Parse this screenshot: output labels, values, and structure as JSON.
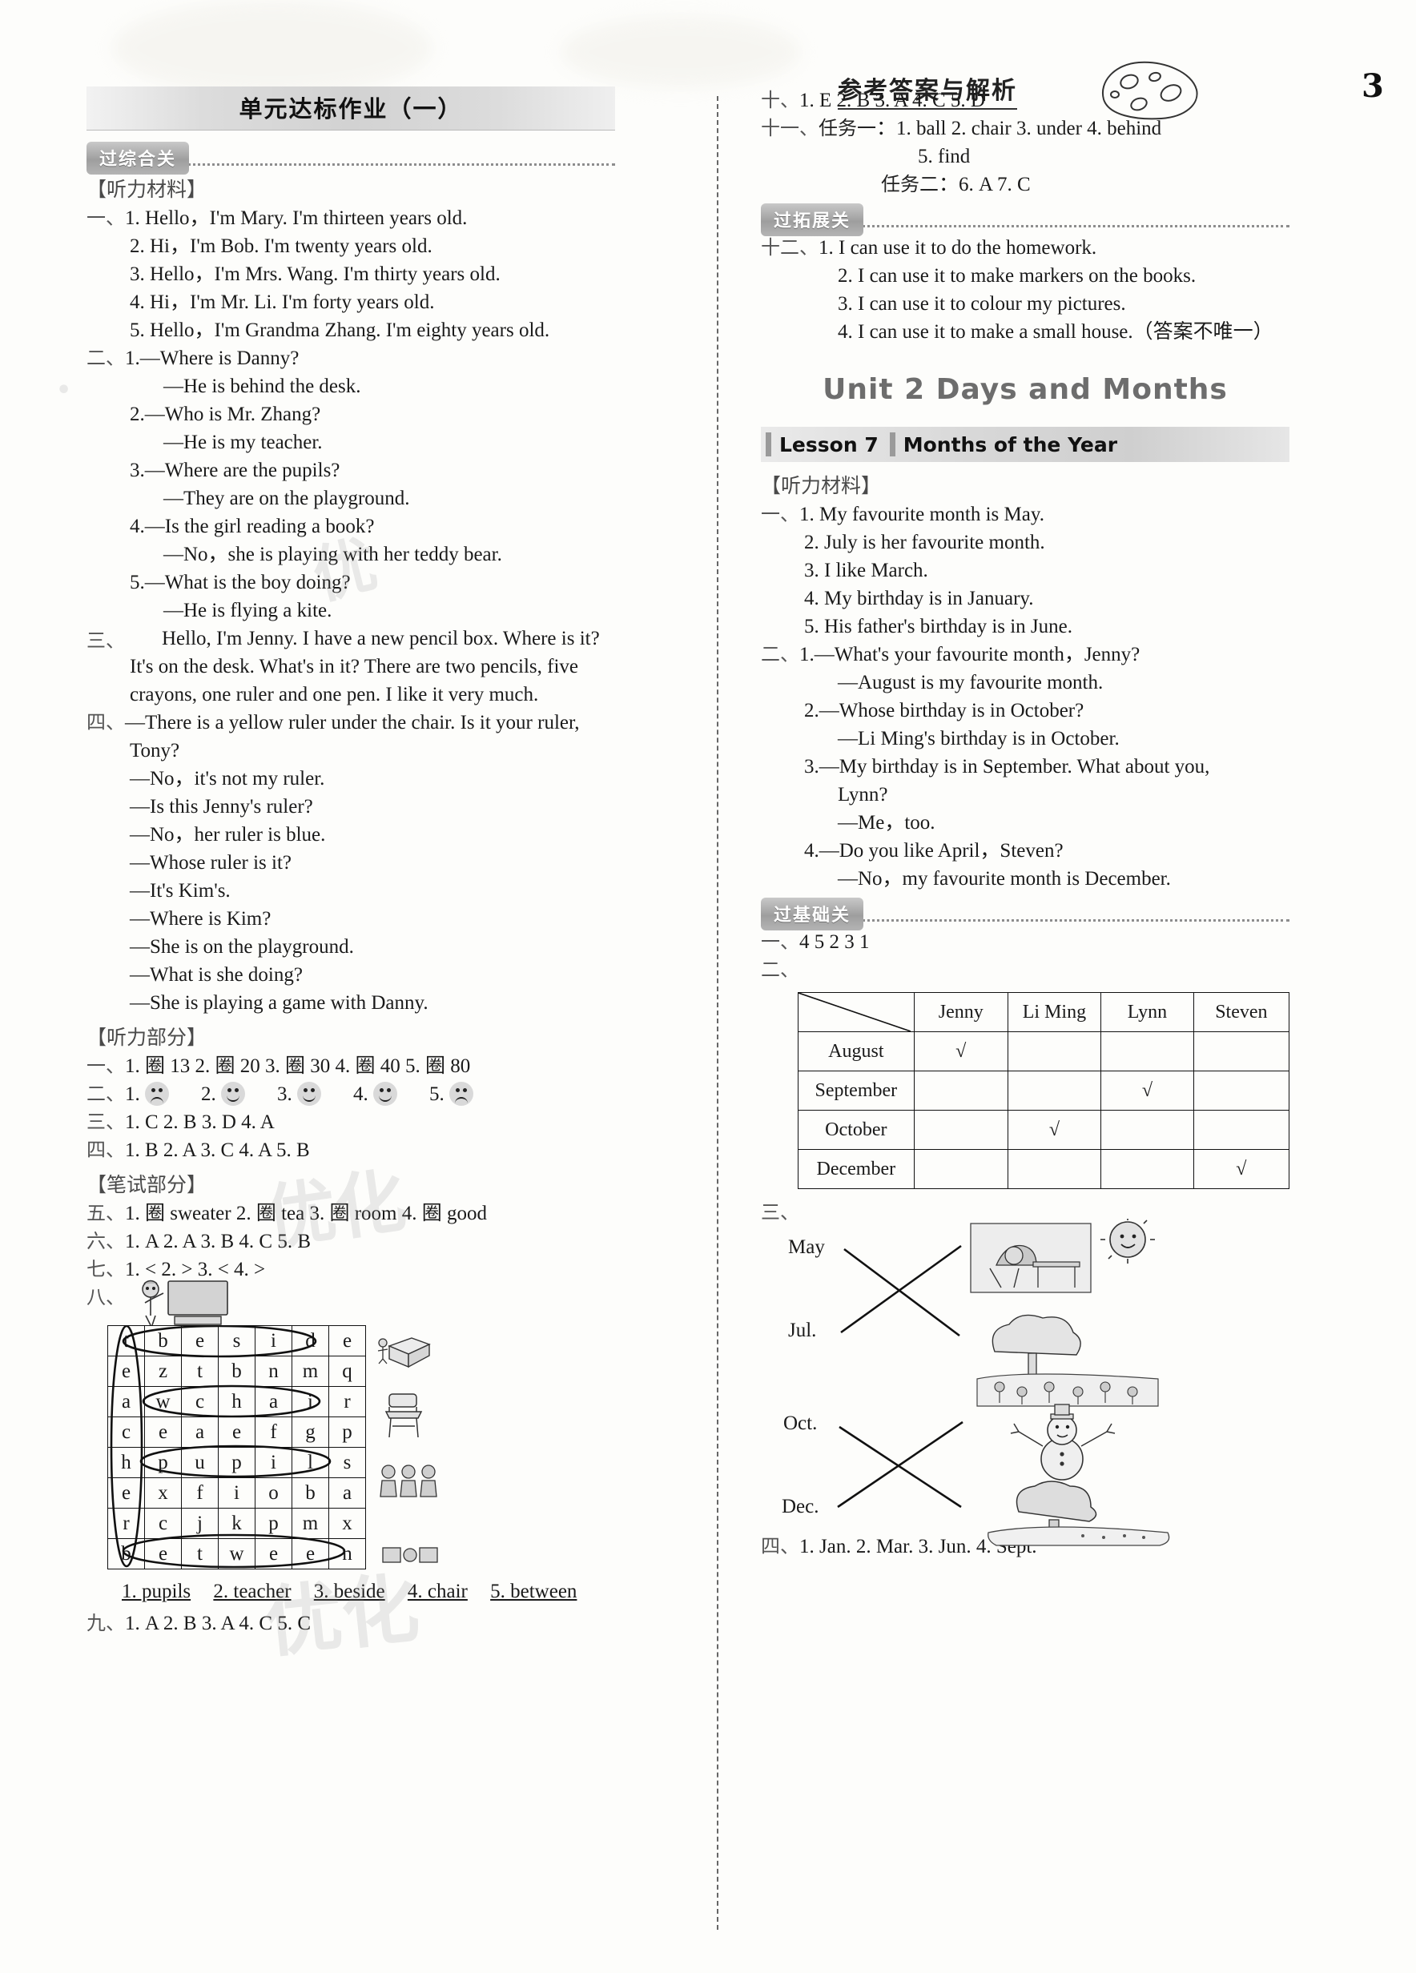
{
  "header": {
    "title": "参考答案与解析",
    "page_number": "3"
  },
  "left_column": {
    "unit_banner": "单元达标作业（一）",
    "gate_1": "过综合关",
    "listening_material_label": "【听力材料】",
    "listening_material": [
      {
        "num": "一、",
        "items": [
          "1. Hello，I'm Mary.  I'm thirteen years old.",
          "2. Hi，I'm Bob.  I'm twenty years old.",
          "3. Hello，I'm Mrs. Wang.  I'm thirty years old.",
          "4. Hi，I'm Mr. Li.  I'm forty years old.",
          "5. Hello，I'm Grandma Zhang.  I'm eighty years old."
        ]
      },
      {
        "num": "二、",
        "items": [
          "1.—Where is Danny?",
          "—He is behind the desk.",
          "2.—Who is Mr. Zhang?",
          "—He is my teacher.",
          "3.—Where are the pupils?",
          "—They are on the playground.",
          "4.—Is the girl reading a book?",
          "—No，she is playing with her teddy bear.",
          "5.—What is the boy doing?",
          "—He is flying a kite."
        ]
      },
      {
        "num": "三、",
        "paragraph": "Hello, I'm Jenny.  I have a new pencil box.  Where is it? It's on the desk.  What's in it? There are two pencils, five crayons, one ruler and one pen.  I like it very much."
      },
      {
        "num": "四、",
        "items": [
          "—There is a yellow ruler under the chair.  Is it your ruler,",
          "Tony?",
          "—No，it's not my ruler.",
          "—Is this Jenny's ruler?",
          "—No，her ruler is blue.",
          "—Whose ruler is it?",
          "—It's Kim's.",
          "—Where is Kim?",
          "—She is on the playground.",
          "—What is she doing?",
          "—She is playing a game with Danny."
        ]
      }
    ],
    "listening_part_label": "【听力部分】",
    "listening_answers": [
      {
        "num": "一、",
        "text": "1. 圈 13   2. 圈 20   3. 圈 30   4. 圈 40   5. 圈 80"
      },
      {
        "num": "二、",
        "faces": [
          "sad",
          "happy",
          "happy",
          "happy",
          "sad"
        ]
      },
      {
        "num": "三、",
        "text": "1. C   2. B   3. D   4. A"
      },
      {
        "num": "四、",
        "text": "1. B   2. A   3. C   4. A    5. B"
      }
    ],
    "written_part_label": "【笔试部分】",
    "written_answers": [
      {
        "num": "五、",
        "text": "1. 圈 sweater   2. 圈 tea   3. 圈 room   4. 圈 good"
      },
      {
        "num": "六、",
        "text": "1. A   2. A   3. B   4. C    5. B"
      },
      {
        "num": "七、",
        "text": "1. <    2. >    3. <   4. >"
      },
      {
        "num": "八、",
        "text": ""
      }
    ],
    "word_grid": {
      "rows": [
        [
          "t",
          "b",
          "e",
          "s",
          "i",
          "d",
          "e"
        ],
        [
          "e",
          "z",
          "t",
          "b",
          "n",
          "m",
          "q"
        ],
        [
          "a",
          "w",
          "c",
          "h",
          "a",
          "i",
          "r"
        ],
        [
          "c",
          "e",
          "a",
          "e",
          "f",
          "g",
          "p"
        ],
        [
          "h",
          "p",
          "u",
          "p",
          "i",
          "l",
          "s"
        ],
        [
          "e",
          "x",
          "f",
          "i",
          "o",
          "b",
          "a"
        ],
        [
          "r",
          "c",
          "j",
          "k",
          "p",
          "m",
          "x"
        ],
        [
          "b",
          "e",
          "t",
          "w",
          "e",
          "e",
          "n"
        ]
      ],
      "answers": [
        "1. pupils",
        "2. teacher",
        "3. beside",
        "4. chair",
        "5. between"
      ]
    },
    "final_answer": {
      "num": "九、",
      "text": "1. A   2. B   3. A   4. C   5. C"
    }
  },
  "right_column": {
    "answers_top": [
      {
        "num": "十、",
        "text": "1. E   2. B    3. A    4. C    5. D"
      },
      {
        "num": "十一、",
        "label": "任务一",
        "text": "1. ball     2. chair     3. under     4. behind"
      },
      {
        "num": "",
        "text": "5. find"
      },
      {
        "num": "",
        "label": "任务二",
        "text": "6. A    7. C"
      }
    ],
    "gate_2": "过拓展关",
    "expand_answers": {
      "num": "十二、",
      "items": [
        "1. I can use it to do the homework.",
        "2. I can use it to make markers on the books.",
        "3. I can use it to colour my pictures.",
        "4. I can use it to make a small house.（答案不唯一）"
      ]
    },
    "unit2_title": "Unit 2    Days and Months",
    "lesson": {
      "number": "Lesson 7",
      "name": "Months of the Year"
    },
    "listening_material_label": "【听力材料】",
    "listening_material": [
      {
        "num": "一、",
        "items": [
          "1. My favourite month is May.",
          "2. July is her favourite month.",
          "3. I like March.",
          "4. My birthday is in January.",
          "5. His father's birthday is in June."
        ]
      },
      {
        "num": "二、",
        "items": [
          "1.—What's your favourite month，Jenny?",
          "—August is my favourite month.",
          "2.—Whose birthday is in October?",
          "—Li Ming's birthday is in October.",
          "3.—My birthday is in September.  What about you,",
          "Lynn?",
          "—Me，too.",
          "4.—Do you like April，Steven?",
          "—No，my favourite month is December."
        ]
      }
    ],
    "gate_3": "过基础关",
    "basic_answers": [
      {
        "num": "一、",
        "text": "4  5  2  3  1"
      },
      {
        "num": "二、",
        "type": "table"
      },
      {
        "num": "三、",
        "type": "matching"
      },
      {
        "num": "四、",
        "text": "1. Jan.    2. Mar.    3. Jun.    4. Sept."
      }
    ],
    "month_table": {
      "header": [
        "",
        "Jenny",
        "Li Ming",
        "Lynn",
        "Steven"
      ],
      "rows": [
        {
          "month": "August",
          "checks": [
            true,
            false,
            false,
            false
          ]
        },
        {
          "month": "September",
          "checks": [
            false,
            false,
            true,
            false
          ]
        },
        {
          "month": "October",
          "checks": [
            false,
            true,
            false,
            false
          ]
        },
        {
          "month": "December",
          "checks": [
            false,
            false,
            false,
            true
          ]
        }
      ],
      "check_mark": "√"
    },
    "matching": {
      "left_labels": [
        "May",
        "Jul.",
        "Oct.",
        "Dec."
      ],
      "pairs": [
        {
          "from": "May",
          "to_image": "picnic-in-sun"
        },
        {
          "from": "Jul.",
          "to_image": "summer-tree-flowers"
        },
        {
          "from": "Oct.",
          "to_image": "autumn-tree"
        },
        {
          "from": "Dec.",
          "to_image": "snowman"
        }
      ]
    }
  }
}
